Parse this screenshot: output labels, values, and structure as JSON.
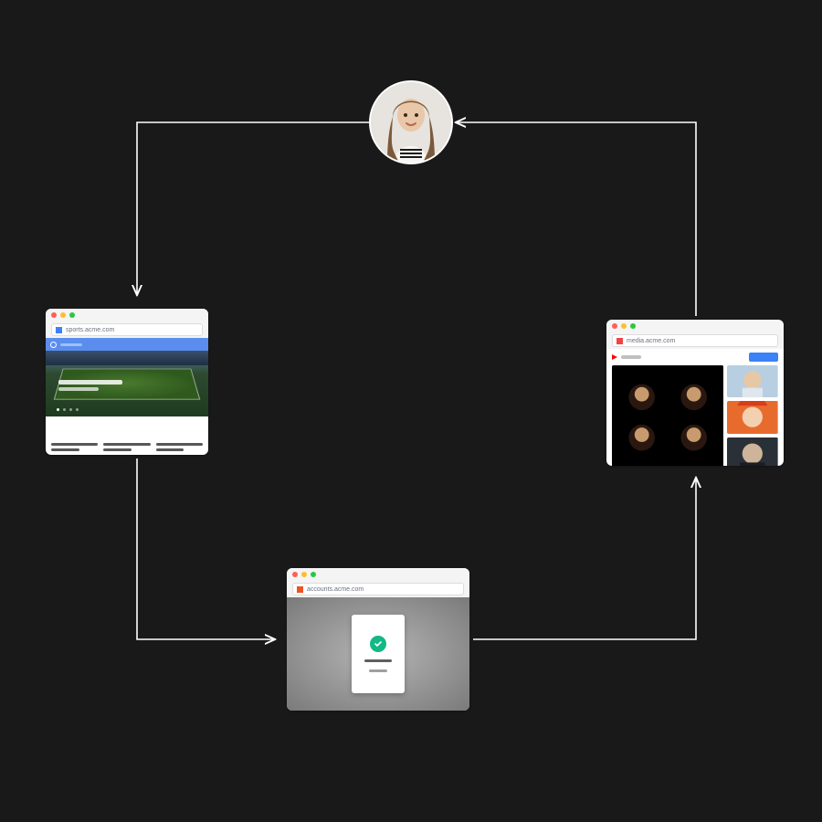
{
  "avatar": {
    "alt": "User"
  },
  "windows": {
    "sports": {
      "url": "sports.acme.com",
      "favicon": "blue"
    },
    "accounts": {
      "url": "accounts.acme.com",
      "favicon": "orange"
    },
    "media": {
      "url": "media.acme.com",
      "favicon": "red"
    }
  },
  "flow": [
    "avatar",
    "sports",
    "accounts",
    "media",
    "avatar"
  ]
}
